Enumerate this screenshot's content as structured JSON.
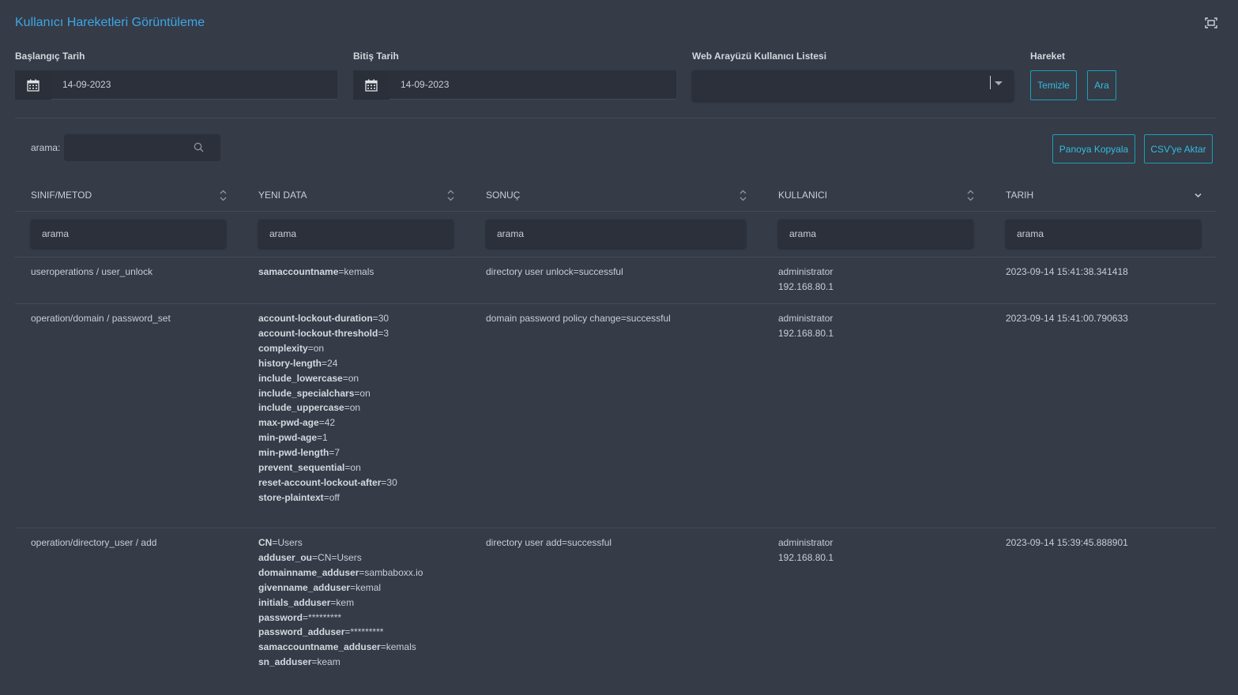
{
  "page": {
    "title": "Kullanıcı Hareketleri Görüntüleme"
  },
  "filters": {
    "start_label": "Başlangıç Tarih",
    "start_value": "14-09-2023",
    "end_label": "Bitiş Tarih",
    "end_value": "14-09-2023",
    "user_list_label": "Web Arayüzü Kullanıcı Listesi",
    "user_list_value": "",
    "action_label": "Hareket",
    "clear_button": "Temizle",
    "search_button": "Ara"
  },
  "toolbar": {
    "search_label": "arama:",
    "search_value": "",
    "copy_button": "Panoya Kopyala",
    "csv_button": "CSV'ye Aktar"
  },
  "table": {
    "columns": [
      "SINIF/METOD",
      "YENI DATA",
      "SONUÇ",
      "KULLANICI",
      "TARIH"
    ],
    "column_filter_placeholder": "arama",
    "rows": [
      {
        "method": "useroperations / user_unlock",
        "data": [
          {
            "k": "samaccountname",
            "v": "kemals"
          }
        ],
        "result": "directory user unlock=successful",
        "user": "administrator",
        "ip": "192.168.80.1",
        "date": "2023-09-14 15:41:38.341418"
      },
      {
        "method": "operation/domain / password_set",
        "data": [
          {
            "k": "account-lockout-duration",
            "v": "30"
          },
          {
            "k": "account-lockout-threshold",
            "v": "3"
          },
          {
            "k": "complexity",
            "v": "on"
          },
          {
            "k": "history-length",
            "v": "24"
          },
          {
            "k": "include_lowercase",
            "v": "on"
          },
          {
            "k": "include_specialchars",
            "v": "on"
          },
          {
            "k": "include_uppercase",
            "v": "on"
          },
          {
            "k": "max-pwd-age",
            "v": "42"
          },
          {
            "k": "min-pwd-age",
            "v": "1"
          },
          {
            "k": "min-pwd-length",
            "v": "7"
          },
          {
            "k": "prevent_sequential",
            "v": "on"
          },
          {
            "k": "reset-account-lockout-after",
            "v": "30"
          },
          {
            "k": "store-plaintext",
            "v": "off"
          }
        ],
        "result": "domain password policy change=successful",
        "user": "administrator",
        "ip": "192.168.80.1",
        "date": "2023-09-14 15:41:00.790633"
      },
      {
        "method": "operation/directory_user / add",
        "data": [
          {
            "k": "CN",
            "v": "Users"
          },
          {
            "k": "adduser_ou",
            "v": "CN=Users"
          },
          {
            "k": "domainname_adduser",
            "v": "sambaboxx.io"
          },
          {
            "k": "givenname_adduser",
            "v": "kemal"
          },
          {
            "k": "initials_adduser",
            "v": "kem"
          },
          {
            "k": "password",
            "v": "*********"
          },
          {
            "k": "password_adduser",
            "v": "*********"
          },
          {
            "k": "samaccountname_adduser",
            "v": "kemals"
          },
          {
            "k": "sn_adduser",
            "v": "keam"
          }
        ],
        "result": "directory user add=successful",
        "user": "administrator",
        "ip": "192.168.80.1",
        "date": "2023-09-14 15:39:45.888901"
      }
    ]
  },
  "icons": {
    "expand": "expand-icon",
    "calendar": "calendar-icon",
    "search": "search-icon",
    "sort": "sort-icon",
    "sort_desc": "sort-desc-icon",
    "dropdown": "chevron-down-icon"
  },
  "colors": {
    "background": "#353b47",
    "input": "#2b303a",
    "accent": "#17a2b8",
    "title": "#3ea7e6"
  }
}
